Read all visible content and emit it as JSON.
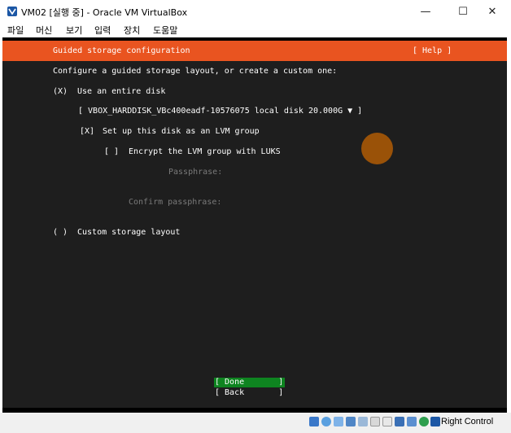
{
  "window": {
    "title": "VM02 [실행 중] - Oracle VM VirtualBox",
    "minimize": "—",
    "maximize": "☐",
    "close": "✕"
  },
  "menubar": {
    "items": [
      "파일",
      "머신",
      "보기",
      "입력",
      "장치",
      "도움말"
    ]
  },
  "installer": {
    "header_title": "Guided storage configuration",
    "help_label": "[ Help ]",
    "intro": "Configure a guided storage layout, or create a custom one:",
    "use_entire_disk_marker": "(X)",
    "use_entire_disk_label": "Use an entire disk",
    "disk_select": "[ VBOX_HARDDISK_VBc400eadf-10576075 local disk 20.000G ▼ ]",
    "lvm_marker": "[X]",
    "lvm_label": "Set up this disk as an LVM group",
    "encrypt_marker": "[ ]",
    "encrypt_label": "Encrypt the LVM group with LUKS",
    "passphrase_label": "Passphrase:",
    "confirm_passphrase_label": "Confirm passphrase:",
    "custom_marker": "( )",
    "custom_label": "Custom storage layout",
    "done_button": "[ Done       ]",
    "back_button": "[ Back       ]"
  },
  "statusbar": {
    "host_key": "Right Control"
  },
  "colors": {
    "header": "#e95420",
    "done_button": "#0e8420",
    "terminal_bg": "#1e1e1e"
  }
}
